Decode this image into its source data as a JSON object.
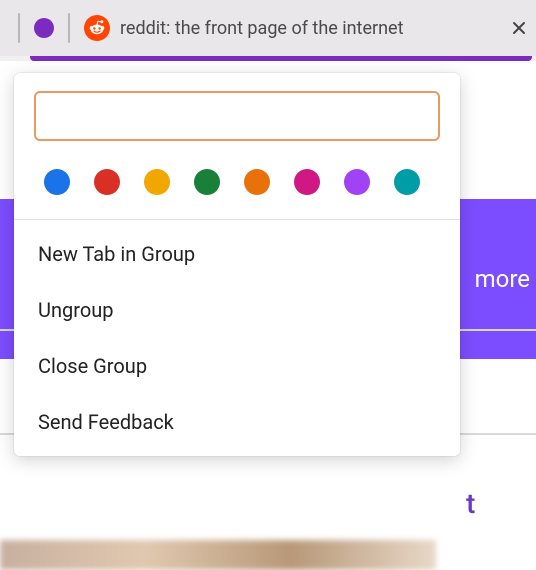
{
  "tabstrip": {
    "group_dot_color": "#7b2cbf",
    "tab": {
      "title": "reddit: the front page of the internet",
      "favicon_bg": "#ff4500"
    }
  },
  "background": {
    "banner_text": "more"
  },
  "popup": {
    "name_value": "",
    "name_placeholder": "",
    "colors": [
      {
        "name": "blue",
        "hex": "#1a73e8"
      },
      {
        "name": "red",
        "hex": "#d93025"
      },
      {
        "name": "yellow",
        "hex": "#f2a600"
      },
      {
        "name": "green",
        "hex": "#188038"
      },
      {
        "name": "orange",
        "hex": "#e8710a"
      },
      {
        "name": "pink",
        "hex": "#d01884"
      },
      {
        "name": "purple",
        "hex": "#a142f4"
      },
      {
        "name": "cyan",
        "hex": "#009da6"
      }
    ],
    "menu": [
      "New Tab in Group",
      "Ungroup",
      "Close Group",
      "Send Feedback"
    ]
  }
}
